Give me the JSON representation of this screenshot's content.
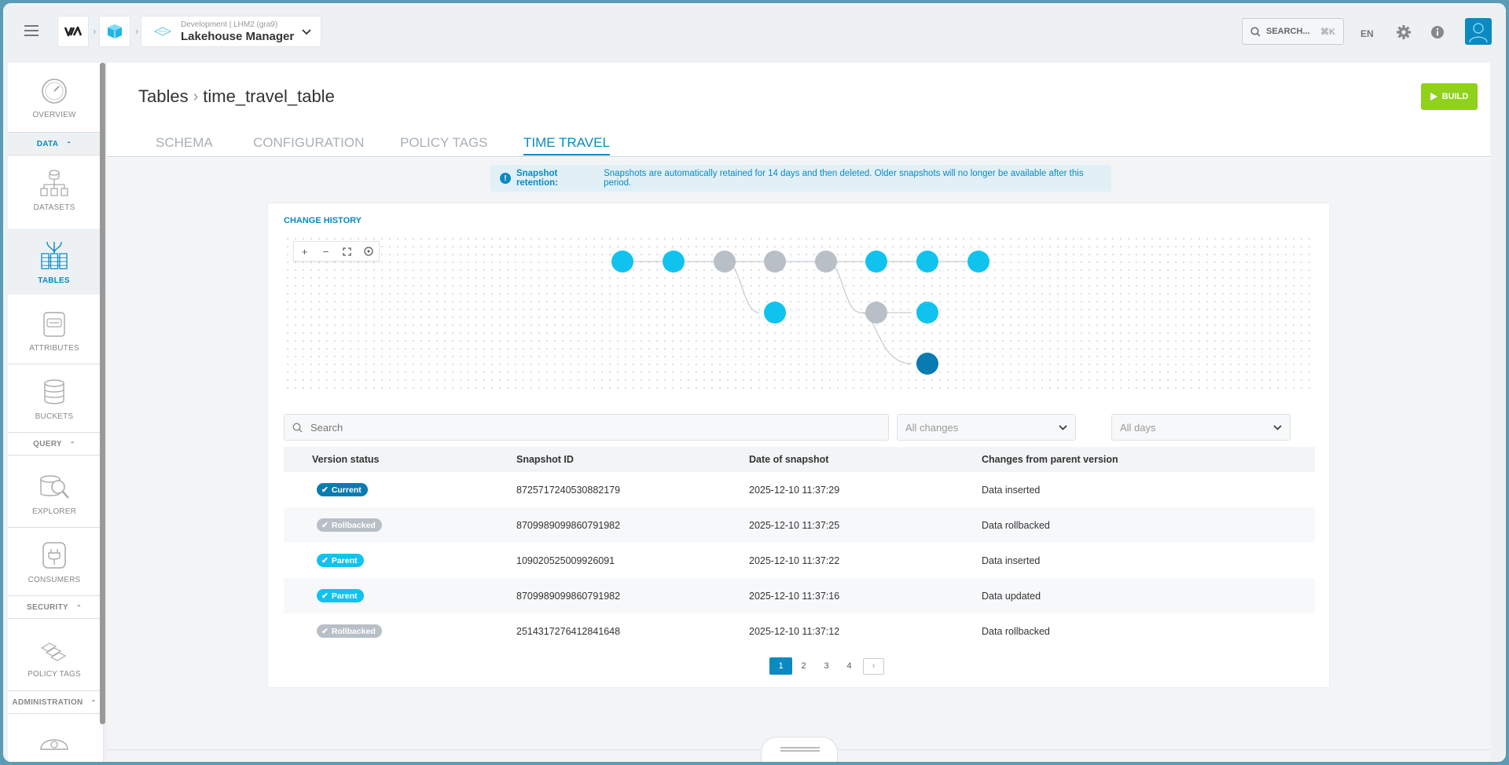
{
  "topbar": {
    "project_env": "Development | LHM2 (gra9)",
    "project_name": "Lakehouse Manager",
    "search_label": "SEARCH...",
    "search_shortcut": "⌘K",
    "language": "EN"
  },
  "sidebar": {
    "overview": "OVERVIEW",
    "section_data": "DATA",
    "datasets": "DATASETS",
    "tables": "TABLES",
    "attributes": "ATTRIBUTES",
    "buckets": "BUCKETS",
    "section_query": "QUERY",
    "explorer": "EXPLORER",
    "consumers": "CONSUMERS",
    "section_security": "SECURITY",
    "policy_tags": "POLICY TAGS",
    "section_administration": "ADMINISTRATION"
  },
  "main": {
    "breadcrumb_root": "Tables",
    "breadcrumb_current": "time_travel_table",
    "build_label": "BUILD",
    "tabs": [
      {
        "label": "SCHEMA"
      },
      {
        "label": "CONFIGURATION"
      },
      {
        "label": "POLICY TAGS"
      },
      {
        "label": "TIME TRAVEL"
      }
    ],
    "retention_title": "Snapshot retention:",
    "retention_text": "Snapshots are automatically retained for 14 days and then deleted. Older snapshots will no longer be available after this period.",
    "change_history_title": "CHANGE HISTORY",
    "zoom_in": "+",
    "zoom_out": "−",
    "search_placeholder": "Search",
    "filter_changes": "All changes",
    "filter_days": "All days",
    "table_headers": {
      "status": "Version status",
      "snapshot_id": "Snapshot ID",
      "date": "Date of snapshot",
      "changes": "Changes from parent version"
    },
    "rows": [
      {
        "status": "Current",
        "snapshot_id": "8725717240530882179",
        "date": "2025-12-10 11:37:29",
        "changes": "Data inserted"
      },
      {
        "status": "Rollbacked",
        "snapshot_id": "8709989099860791982",
        "date": "2025-12-10 11:37:25",
        "changes": "Data rollbacked"
      },
      {
        "status": "Parent",
        "snapshot_id": "109020525009926091",
        "date": "2025-12-10 11:37:22",
        "changes": "Data inserted"
      },
      {
        "status": "Parent",
        "snapshot_id": "8709989099860791982",
        "date": "2025-12-10 11:37:16",
        "changes": "Data updated"
      },
      {
        "status": "Rollbacked",
        "snapshot_id": "2514317276412841648",
        "date": "2025-12-10 11:37:12",
        "changes": "Data rollbacked"
      }
    ],
    "pages": [
      "1",
      "2",
      "3",
      "4"
    ],
    "next_page": "›"
  },
  "colors": {
    "accent": "#0a8ac0",
    "node_active": "#10c3ef",
    "node_inactive": "#b8bfc6",
    "node_current": "#0a7bb0",
    "build": "#8fd11c"
  }
}
